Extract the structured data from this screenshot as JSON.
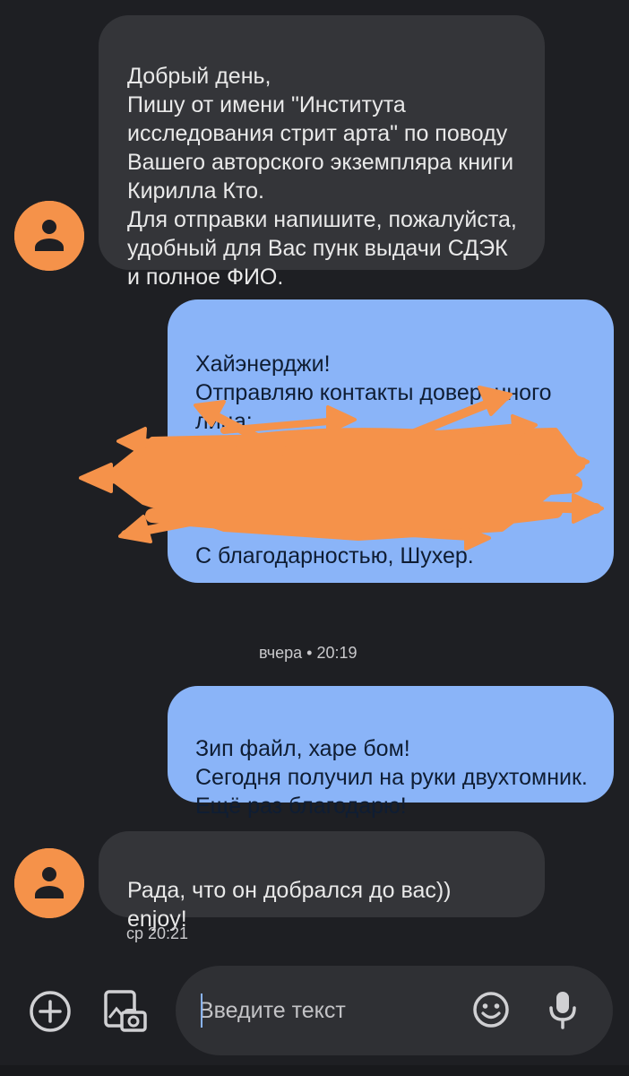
{
  "conversation": {
    "messages": [
      {
        "direction": "incoming",
        "text": "Добрый день,\nПишу от имени \"Института исследования стрит арта\" по поводу Вашего авторского экземпляра книги Кирилла Кто.\nДля отправки напишите, пожалуйста,  удобный для Вас пунк выдачи СДЭК и полное ФИО."
      },
      {
        "direction": "outgoing",
        "text": "Хайэнерджи!\nОтправляю контакты доверенного лица:",
        "signature": "С благодарностью, Шухер."
      },
      {
        "direction": "outgoing",
        "text": "Зип файл, харе бом!\nСегодня получил на руки двухтомник. Ещё раз благодарю!"
      },
      {
        "direction": "incoming",
        "text": "Рада, что он добрался до вас))\nenjoy!",
        "time": "ср 20:21"
      }
    ],
    "day_separator": "вчера • 20:19"
  },
  "composer": {
    "placeholder": "Введите текст",
    "add_icon": "plus-circle-icon",
    "gallery_icon": "gallery-camera-icon",
    "emoji_icon": "emoji-icon",
    "mic_icon": "microphone-icon"
  },
  "colors": {
    "background": "#1e1f23",
    "incoming_bubble": "#343539",
    "outgoing_bubble": "#8ab4f8",
    "avatar": "#f5924a",
    "redaction": "#f5924a"
  }
}
